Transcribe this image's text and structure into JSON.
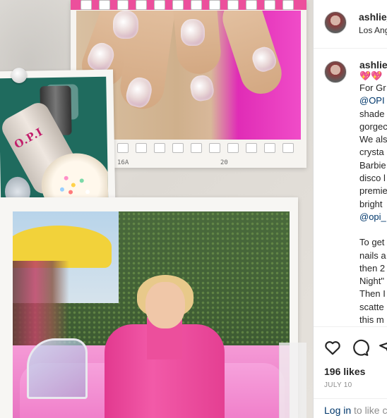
{
  "header": {
    "username": "ashlie_",
    "location": "Los Ang"
  },
  "caption": {
    "username": "ashlie_",
    "emoji": "💖💖",
    "lines": [
      "For Gr",
      "@OPI",
      "shade",
      "gorgec",
      "We als",
      "crysta",
      "Barbie",
      "disco l",
      "premie",
      "bright",
      "@opi_"
    ],
    "lines2": [
      "To get",
      "nails a",
      "then 2",
      "Night\"",
      "Then I",
      "scatte",
      "this m"
    ]
  },
  "actions": {
    "likes": "196 likes",
    "date": "JULY 10",
    "login_link": "Log in",
    "login_rest": "to like c"
  },
  "collage": {
    "film_codes": [
      "16A",
      "20"
    ],
    "bottle_label": "O.P.I"
  },
  "colors": {
    "link": "#00376b",
    "text": "#262626",
    "muted": "#8e8e8e",
    "pink": "#e2398f"
  }
}
